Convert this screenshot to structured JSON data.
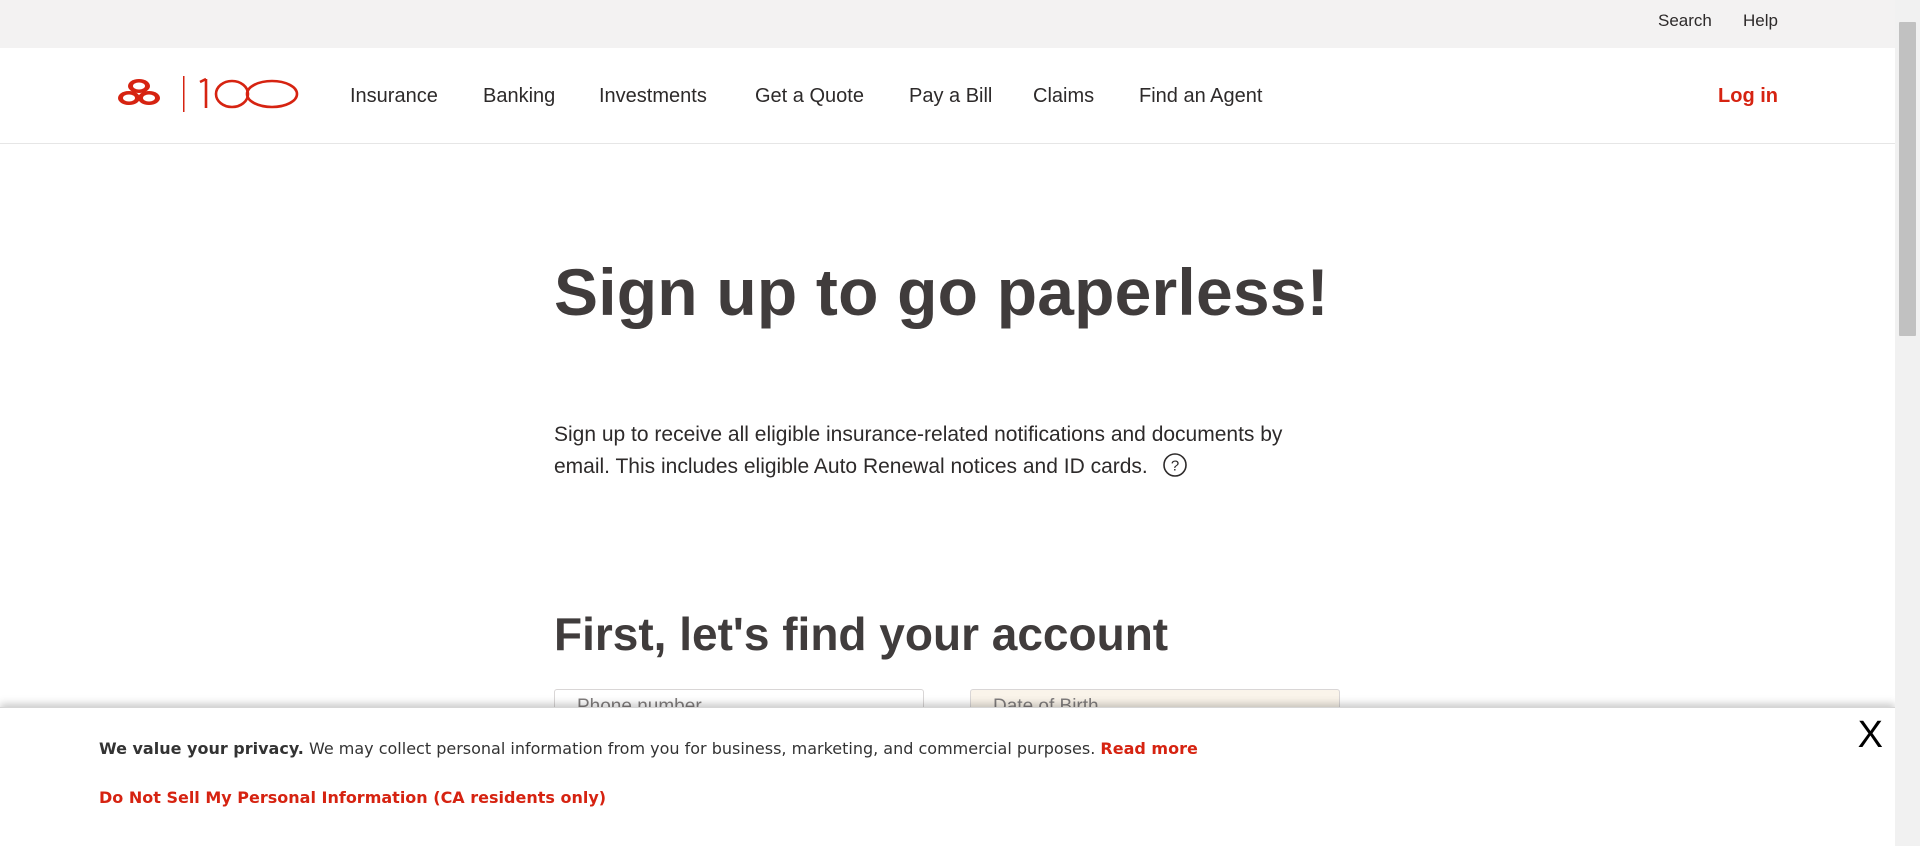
{
  "utility": {
    "search_label": "Search",
    "help_label": "Help"
  },
  "header": {
    "logo_text": "100",
    "nav_items": [
      "Insurance",
      "Banking",
      "Investments",
      "Get a Quote",
      "Pay a Bill",
      "Claims",
      "Find an Agent"
    ],
    "login_label": "Log in"
  },
  "main": {
    "title": "Sign up to go paperless!",
    "intro": "Sign up to receive all eligible insurance-related notifications and documents by email. This includes eligible Auto Renewal notices and ID cards.",
    "help_icon": "question-circle-icon",
    "section_title": "First, let's find your account",
    "phone_placeholder": "Phone number",
    "dob_placeholder": "Date of Birth"
  },
  "privacy": {
    "heading": "We value your privacy.",
    "text": " We may collect personal information from you for business, marketing, and commercial purposes. ",
    "read_more": "Read more",
    "dns_link": "Do Not Sell My Personal Information (CA residents only)",
    "close_label": "X"
  },
  "colors": {
    "brand_red": "#d62311",
    "text_dark": "#403c3c",
    "utility_bg": "#f3f2f2"
  }
}
